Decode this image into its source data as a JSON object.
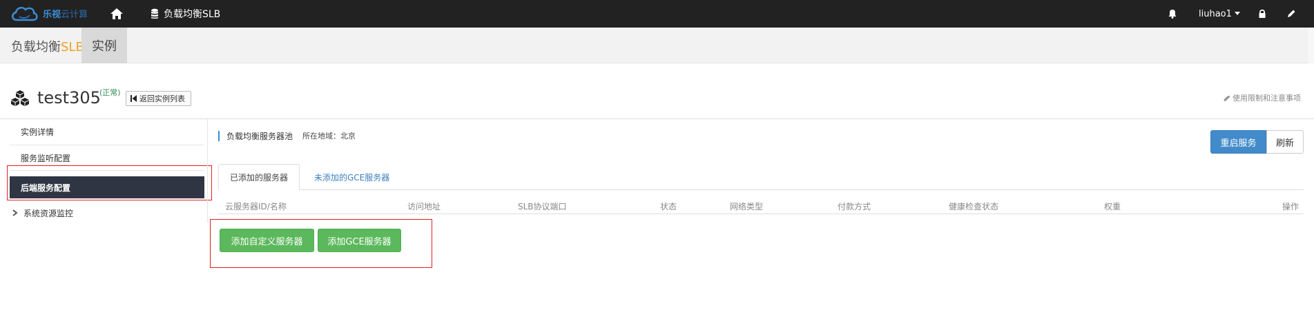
{
  "navbar": {
    "logo_text": "乐视",
    "logo_text_suffix": "云计算",
    "product_label": "负载均衡SLB",
    "username": "liuhao1",
    "icons": {
      "home": "home-icon",
      "product": "database-icon",
      "notifications": "bell-icon",
      "lock": "lock-icon",
      "edit": "pencil-icon"
    }
  },
  "subheader": {
    "brand_prefix": "负载均衡",
    "brand_accent": "SLB",
    "instance_tab": "实例"
  },
  "instance": {
    "name": "test305",
    "status": "(正常)",
    "back_button": "返回实例列表",
    "limits_link": "使用限制和注意事项"
  },
  "sidebar": {
    "items": [
      {
        "label": "实例详情"
      },
      {
        "label": "服务监听配置"
      },
      {
        "label": "后端服务配置",
        "active": true
      },
      {
        "label": "系统资源监控",
        "expandable": true
      }
    ]
  },
  "main": {
    "pool_title": "负载均衡服务器池",
    "region_label": "所在地域：北京",
    "restart_button": "重启服务",
    "refresh_button": "刷新",
    "tabs": [
      {
        "label": "已添加的服务器",
        "active": true
      },
      {
        "label": "未添加的GCE服务器",
        "active": false
      }
    ],
    "table_headers": [
      "云服务器ID/名称",
      "访问地址",
      "SLB协议端口",
      "状态",
      "网络类型",
      "付款方式",
      "健康检查状态",
      "权重",
      "操作"
    ],
    "add_custom_button": "添加自定义服务器",
    "add_gce_button": "添加GCE服务器"
  },
  "colors": {
    "navbar_bg": "#222222",
    "primary": "#428bca",
    "success": "#5cb85c",
    "accent": "#f0a020",
    "sidebar_active_bg": "#2f3542",
    "highlight_box": "#e02020",
    "link": "#3a7fc0"
  }
}
